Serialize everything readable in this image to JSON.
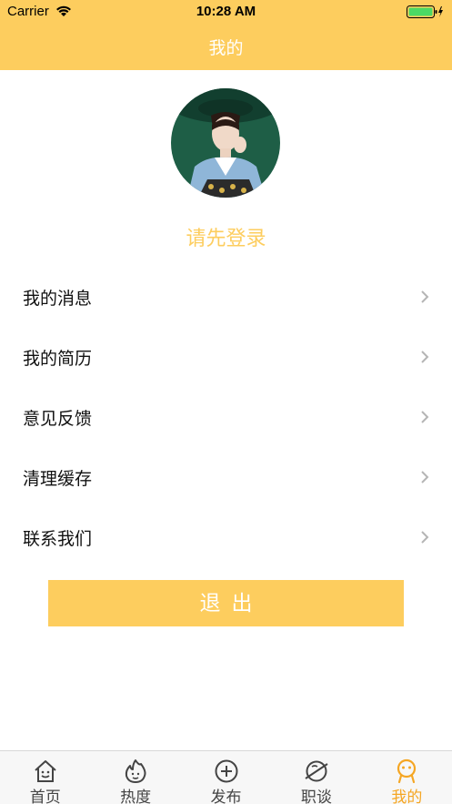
{
  "status_bar": {
    "carrier": "Carrier",
    "time": "10:28 AM"
  },
  "nav": {
    "title": "我的"
  },
  "profile": {
    "login_hint": "请先登录"
  },
  "menu": {
    "items": [
      {
        "label": "我的消息"
      },
      {
        "label": "我的简历"
      },
      {
        "label": "意见反馈"
      },
      {
        "label": "清理缓存"
      },
      {
        "label": "联系我们"
      }
    ]
  },
  "logout": {
    "label": "退出"
  },
  "tabs": [
    {
      "label": "首页",
      "icon": "home-icon"
    },
    {
      "label": "热度",
      "icon": "flame-icon"
    },
    {
      "label": "发布",
      "icon": "plus-circle-icon"
    },
    {
      "label": "职谈",
      "icon": "planet-icon"
    },
    {
      "label": "我的",
      "icon": "profile-icon",
      "active": true
    }
  ],
  "colors": {
    "accent": "#fdcd5e",
    "active_tab": "#f5a623",
    "battery": "#4cd964"
  }
}
